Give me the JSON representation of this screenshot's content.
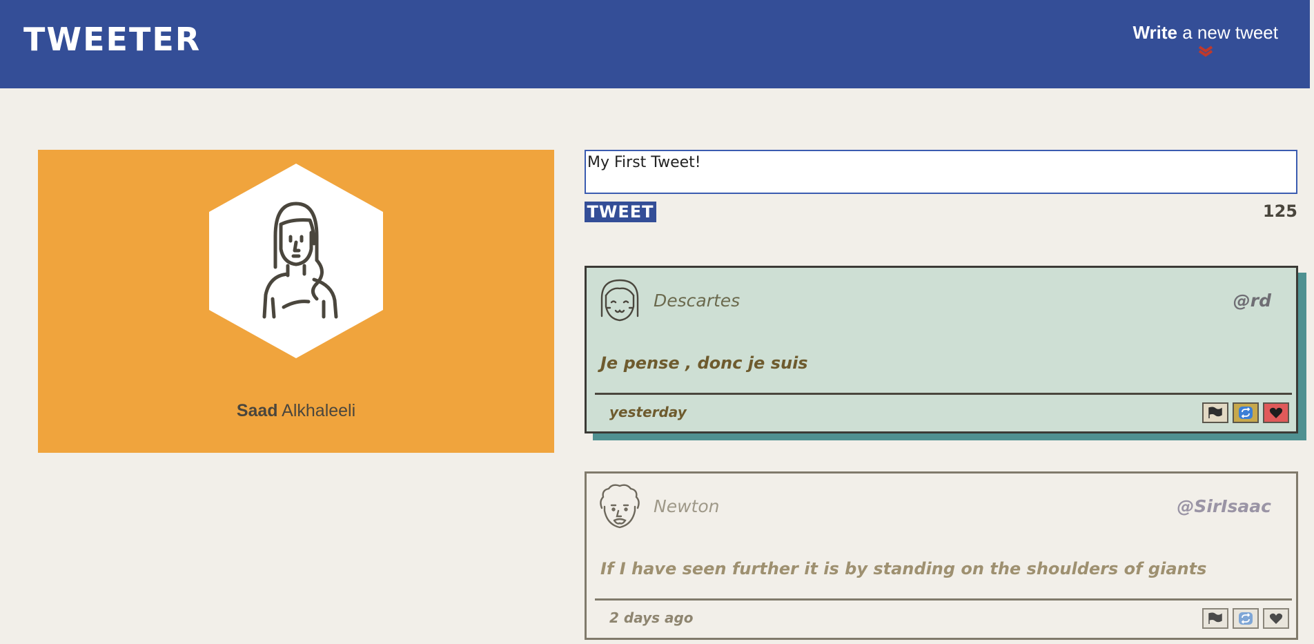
{
  "nav": {
    "brand": "TWEETER",
    "compose_bold": "Write",
    "compose_rest": " a new tweet",
    "compose_icon": "chevron-down-icon",
    "accent_color": "#344e97",
    "chevron_color": "#c0392b"
  },
  "profile": {
    "first_name": "Saad",
    "last_name": " Alkhaleeli",
    "background_color": "#f0a43d"
  },
  "composer": {
    "input_value": "My First Tweet!",
    "submit_label": "TWEET",
    "char_count": "125"
  },
  "tweets": [
    {
      "author": "Descartes",
      "handle": "@rd",
      "content": "Je pense , donc je suis",
      "timestamp": "yesterday",
      "actions": [
        "flag-icon",
        "retweet-icon",
        "heart-icon"
      ]
    },
    {
      "author": "Newton",
      "handle": "@SirIsaac",
      "content": "If I have seen further it is by standing on the shoulders of giants",
      "timestamp": "2 days ago",
      "actions": [
        "flag-icon",
        "retweet-icon",
        "heart-icon"
      ]
    }
  ]
}
